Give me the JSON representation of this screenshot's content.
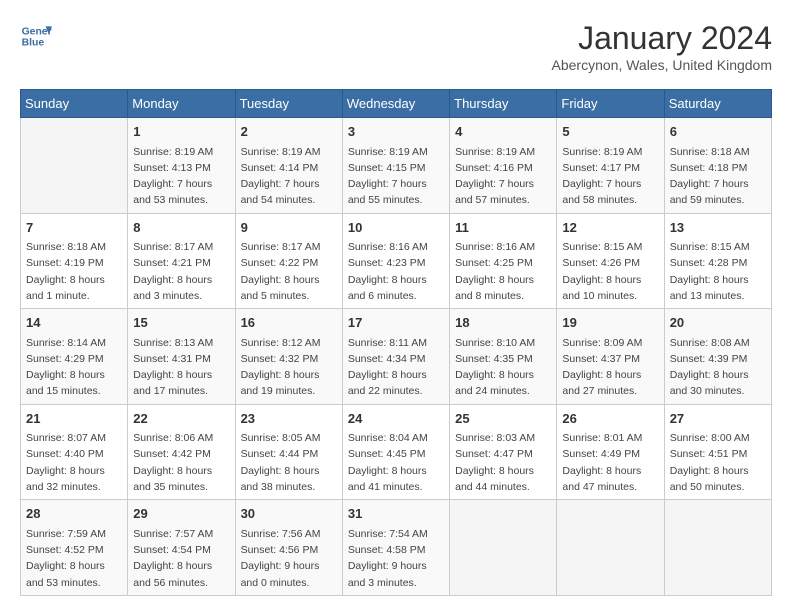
{
  "header": {
    "logo_line1": "General",
    "logo_line2": "Blue",
    "title": "January 2024",
    "subtitle": "Abercynon, Wales, United Kingdom"
  },
  "days_of_week": [
    "Sunday",
    "Monday",
    "Tuesday",
    "Wednesday",
    "Thursday",
    "Friday",
    "Saturday"
  ],
  "weeks": [
    [
      {
        "day": "",
        "info": ""
      },
      {
        "day": "1",
        "info": "Sunrise: 8:19 AM\nSunset: 4:13 PM\nDaylight: 7 hours\nand 53 minutes."
      },
      {
        "day": "2",
        "info": "Sunrise: 8:19 AM\nSunset: 4:14 PM\nDaylight: 7 hours\nand 54 minutes."
      },
      {
        "day": "3",
        "info": "Sunrise: 8:19 AM\nSunset: 4:15 PM\nDaylight: 7 hours\nand 55 minutes."
      },
      {
        "day": "4",
        "info": "Sunrise: 8:19 AM\nSunset: 4:16 PM\nDaylight: 7 hours\nand 57 minutes."
      },
      {
        "day": "5",
        "info": "Sunrise: 8:19 AM\nSunset: 4:17 PM\nDaylight: 7 hours\nand 58 minutes."
      },
      {
        "day": "6",
        "info": "Sunrise: 8:18 AM\nSunset: 4:18 PM\nDaylight: 7 hours\nand 59 minutes."
      }
    ],
    [
      {
        "day": "7",
        "info": "Sunrise: 8:18 AM\nSunset: 4:19 PM\nDaylight: 8 hours\nand 1 minute."
      },
      {
        "day": "8",
        "info": "Sunrise: 8:17 AM\nSunset: 4:21 PM\nDaylight: 8 hours\nand 3 minutes."
      },
      {
        "day": "9",
        "info": "Sunrise: 8:17 AM\nSunset: 4:22 PM\nDaylight: 8 hours\nand 5 minutes."
      },
      {
        "day": "10",
        "info": "Sunrise: 8:16 AM\nSunset: 4:23 PM\nDaylight: 8 hours\nand 6 minutes."
      },
      {
        "day": "11",
        "info": "Sunrise: 8:16 AM\nSunset: 4:25 PM\nDaylight: 8 hours\nand 8 minutes."
      },
      {
        "day": "12",
        "info": "Sunrise: 8:15 AM\nSunset: 4:26 PM\nDaylight: 8 hours\nand 10 minutes."
      },
      {
        "day": "13",
        "info": "Sunrise: 8:15 AM\nSunset: 4:28 PM\nDaylight: 8 hours\nand 13 minutes."
      }
    ],
    [
      {
        "day": "14",
        "info": "Sunrise: 8:14 AM\nSunset: 4:29 PM\nDaylight: 8 hours\nand 15 minutes."
      },
      {
        "day": "15",
        "info": "Sunrise: 8:13 AM\nSunset: 4:31 PM\nDaylight: 8 hours\nand 17 minutes."
      },
      {
        "day": "16",
        "info": "Sunrise: 8:12 AM\nSunset: 4:32 PM\nDaylight: 8 hours\nand 19 minutes."
      },
      {
        "day": "17",
        "info": "Sunrise: 8:11 AM\nSunset: 4:34 PM\nDaylight: 8 hours\nand 22 minutes."
      },
      {
        "day": "18",
        "info": "Sunrise: 8:10 AM\nSunset: 4:35 PM\nDaylight: 8 hours\nand 24 minutes."
      },
      {
        "day": "19",
        "info": "Sunrise: 8:09 AM\nSunset: 4:37 PM\nDaylight: 8 hours\nand 27 minutes."
      },
      {
        "day": "20",
        "info": "Sunrise: 8:08 AM\nSunset: 4:39 PM\nDaylight: 8 hours\nand 30 minutes."
      }
    ],
    [
      {
        "day": "21",
        "info": "Sunrise: 8:07 AM\nSunset: 4:40 PM\nDaylight: 8 hours\nand 32 minutes."
      },
      {
        "day": "22",
        "info": "Sunrise: 8:06 AM\nSunset: 4:42 PM\nDaylight: 8 hours\nand 35 minutes."
      },
      {
        "day": "23",
        "info": "Sunrise: 8:05 AM\nSunset: 4:44 PM\nDaylight: 8 hours\nand 38 minutes."
      },
      {
        "day": "24",
        "info": "Sunrise: 8:04 AM\nSunset: 4:45 PM\nDaylight: 8 hours\nand 41 minutes."
      },
      {
        "day": "25",
        "info": "Sunrise: 8:03 AM\nSunset: 4:47 PM\nDaylight: 8 hours\nand 44 minutes."
      },
      {
        "day": "26",
        "info": "Sunrise: 8:01 AM\nSunset: 4:49 PM\nDaylight: 8 hours\nand 47 minutes."
      },
      {
        "day": "27",
        "info": "Sunrise: 8:00 AM\nSunset: 4:51 PM\nDaylight: 8 hours\nand 50 minutes."
      }
    ],
    [
      {
        "day": "28",
        "info": "Sunrise: 7:59 AM\nSunset: 4:52 PM\nDaylight: 8 hours\nand 53 minutes."
      },
      {
        "day": "29",
        "info": "Sunrise: 7:57 AM\nSunset: 4:54 PM\nDaylight: 8 hours\nand 56 minutes."
      },
      {
        "day": "30",
        "info": "Sunrise: 7:56 AM\nSunset: 4:56 PM\nDaylight: 9 hours\nand 0 minutes."
      },
      {
        "day": "31",
        "info": "Sunrise: 7:54 AM\nSunset: 4:58 PM\nDaylight: 9 hours\nand 3 minutes."
      },
      {
        "day": "",
        "info": ""
      },
      {
        "day": "",
        "info": ""
      },
      {
        "day": "",
        "info": ""
      }
    ]
  ]
}
